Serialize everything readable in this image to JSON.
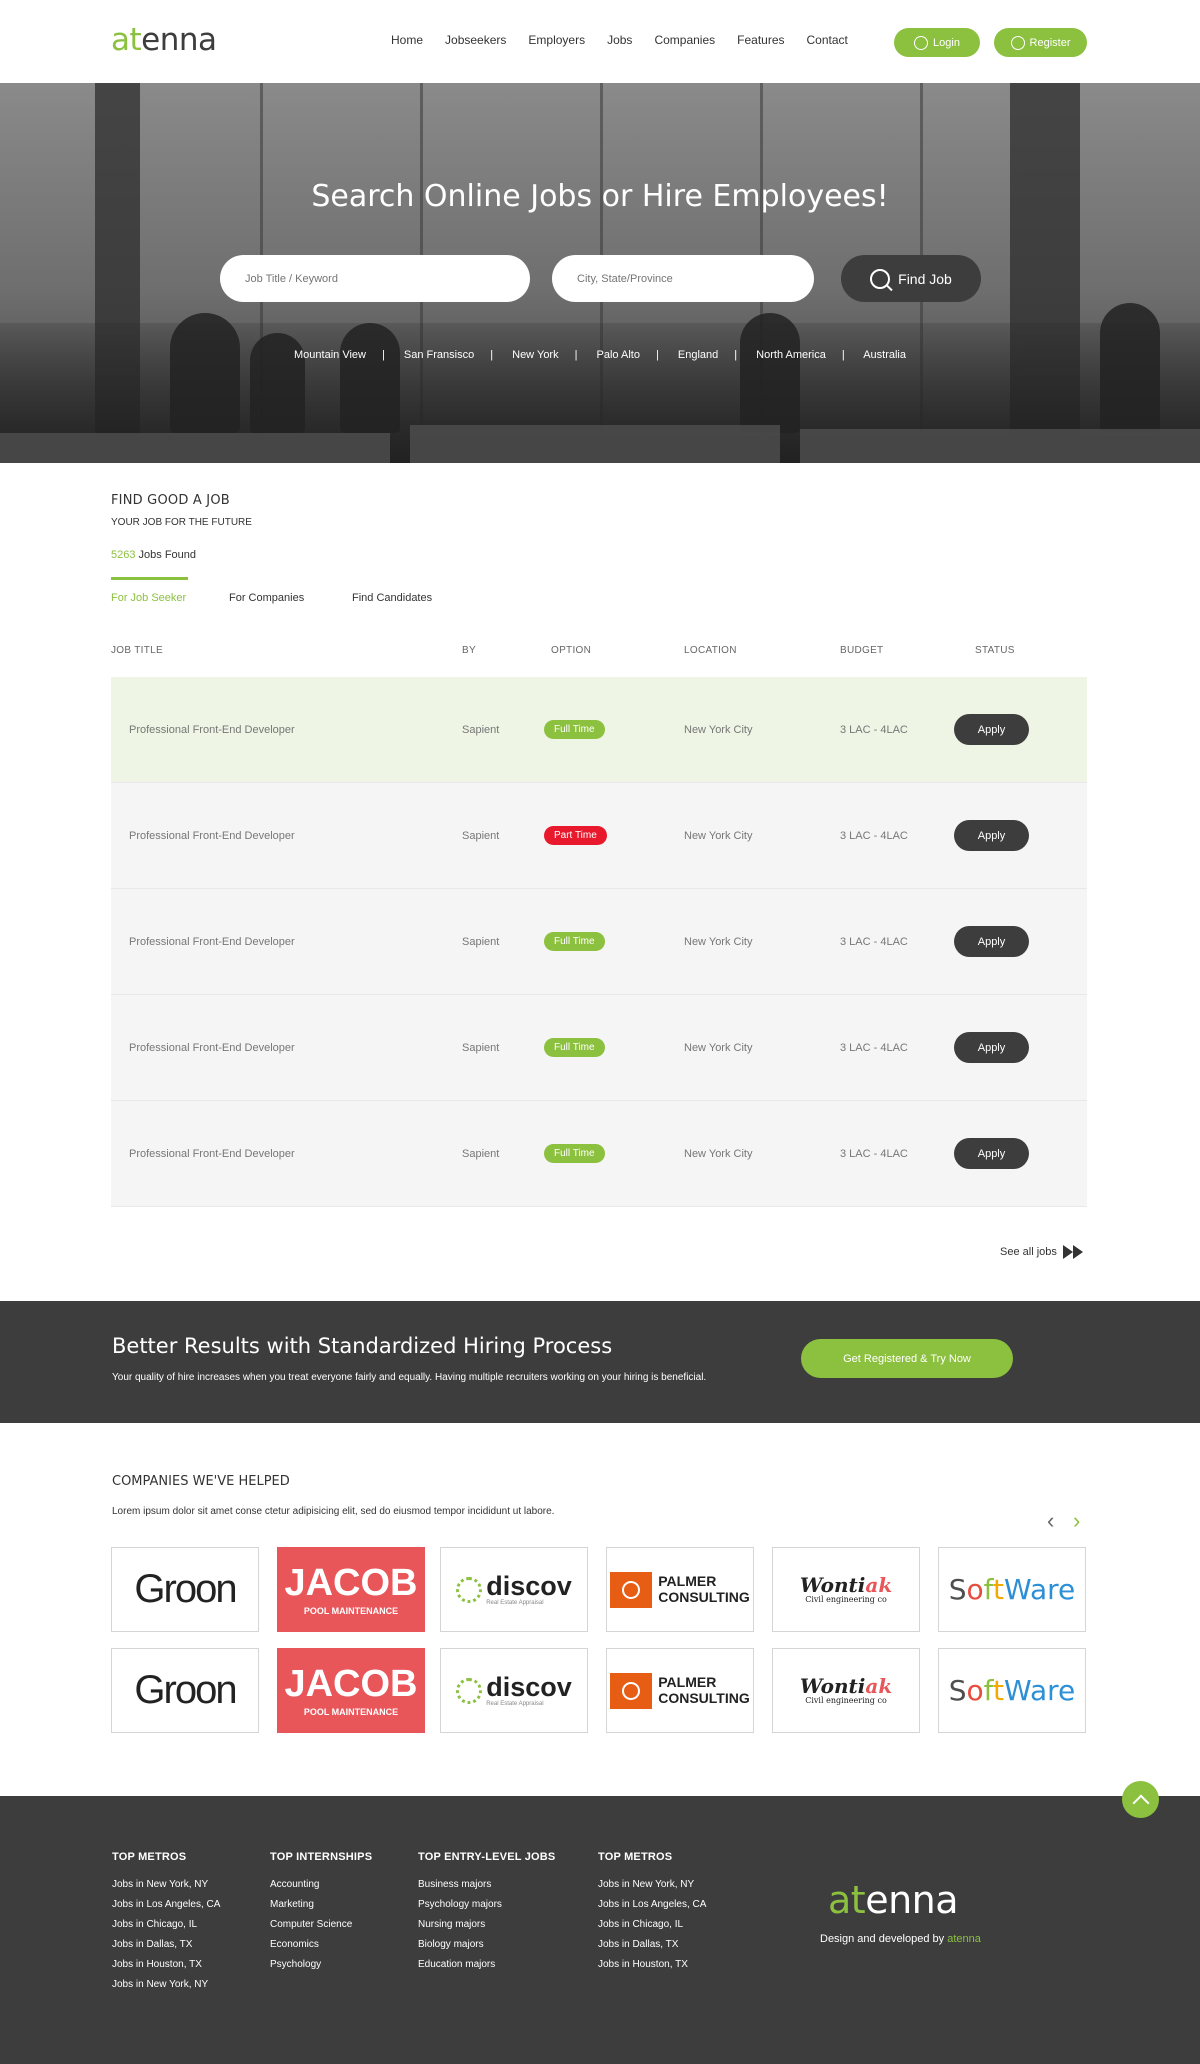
{
  "brand": {
    "logo_prefix": "at",
    "logo_suffix": "enna"
  },
  "nav": [
    {
      "label": "Home"
    },
    {
      "label": "Jobseekers"
    },
    {
      "label": "Employers"
    },
    {
      "label": "Jobs"
    },
    {
      "label": "Companies"
    },
    {
      "label": "Features"
    },
    {
      "label": "Contact"
    }
  ],
  "header": {
    "login_label": "Login",
    "register_label": "Register"
  },
  "hero": {
    "title": "Search Online Jobs or Hire Employees!",
    "keyword_placeholder": "Job Title / Keyword",
    "city_placeholder": "City, State/Province",
    "find_label": "Find Job",
    "cities": [
      "Mountain View",
      "San Fransisco",
      "New York",
      "Palo Alto",
      "England",
      "North America",
      "Australia"
    ],
    "separator": "|"
  },
  "jobs_section": {
    "title": "FIND GOOD A JOB",
    "subtitle": "YOUR JOB FOR THE FUTURE",
    "count": "5263",
    "count_suffix": " Jobs Found",
    "tabs": [
      "For Job Seeker",
      "For Companies",
      "Find Candidates"
    ],
    "columns": [
      "JOB TITLE",
      "BY",
      "OPTION",
      "LOCATION",
      "BUDGET",
      "STATUS"
    ],
    "rows": [
      {
        "title": "Professional Front-End Developer",
        "by": "Sapient",
        "option": "Full Time",
        "option_type": "full",
        "location": "New York City",
        "budget": "3 LAC - 4LAC",
        "status": "Apply"
      },
      {
        "title": "Professional Front-End Developer",
        "by": "Sapient",
        "option": "Part Time",
        "option_type": "part",
        "location": "New York City",
        "budget": "3 LAC - 4LAC",
        "status": "Apply"
      },
      {
        "title": "Professional Front-End Developer",
        "by": "Sapient",
        "option": "Full Time",
        "option_type": "full",
        "location": "New York City",
        "budget": "3 LAC - 4LAC",
        "status": "Apply"
      },
      {
        "title": "Professional Front-End Developer",
        "by": "Sapient",
        "option": "Full Time",
        "option_type": "full",
        "location": "New York City",
        "budget": "3 LAC - 4LAC",
        "status": "Apply"
      },
      {
        "title": "Professional Front-End Developer",
        "by": "Sapient",
        "option": "Full Time",
        "option_type": "full",
        "location": "New York City",
        "budget": "3 LAC - 4LAC",
        "status": "Apply"
      }
    ],
    "see_all": "See all jobs"
  },
  "banner": {
    "title": "Better Results with Standardized Hiring Process",
    "text": "Your quality of hire increases when you treat everyone fairly and equally. Having multiple recruiters working on your hiring is beneficial.",
    "cta": "Get Registered & Try Now"
  },
  "companies": {
    "title": "COMPANIES WE'VE HELPED",
    "text": "Lorem ipsum dolor sit amet conse ctetur adipisicing elit, sed do eiusmod tempor incididunt ut labore.",
    "logos": {
      "groon": "Groon",
      "jacob": "JACOB",
      "jacob_sub": "POOL MAINTENANCE",
      "discov": "discov",
      "discov_sub": "Real Estate Appraisal",
      "palmer_1": "PALMER",
      "palmer_2": "CONSULTING",
      "wontiak_main": "Wonti",
      "wontiak_accent": "ak",
      "wontiak_sub": "Civil engineering co",
      "software_letters": [
        "S",
        "o",
        "f",
        "t",
        "W",
        "a",
        "r",
        "e"
      ]
    }
  },
  "colors": {
    "accent": "#8cc03f",
    "dark": "#3d3d3e",
    "part_time": "#e8192c",
    "software_letters": [
      "#4e4e4e",
      "#e84c3d",
      "#8cc03f",
      "#f2a900",
      "#2d8fd5",
      "#2d8fd5",
      "#2d8fd5",
      "#2d8fd5"
    ]
  },
  "footer": {
    "columns": [
      {
        "title": "TOP METROS",
        "items": [
          "Jobs in New York, NY",
          "Jobs in Los Angeles, CA",
          "Jobs in Chicago, IL",
          "Jobs in Dallas, TX",
          "Jobs in Houston, TX",
          "Jobs in New York, NY"
        ]
      },
      {
        "title": "TOP INTERNSHIPS",
        "items": [
          "Accounting",
          "Marketing",
          "Computer Science",
          "Economics",
          "Psychology"
        ]
      },
      {
        "title": "TOP ENTRY-LEVEL JOBS",
        "items": [
          "Business majors",
          "Psychology majors",
          "Nursing majors",
          "Biology majors",
          "Education majors"
        ]
      },
      {
        "title": "TOP METROS",
        "items": [
          "Jobs in New York, NY",
          "Jobs in Los Angeles, CA",
          "Jobs in Chicago, IL",
          "Jobs in Dallas, TX",
          "Jobs in Houston, TX"
        ]
      }
    ],
    "credit_prefix": "Design and developed by ",
    "credit_brand": "atenna"
  },
  "icons": {
    "login": "user-circle-icon",
    "register": "user-add-icon",
    "search": "search-icon",
    "see_all": "fast-forward-icon",
    "prev": "chevron-left-icon",
    "next": "chevron-right-icon",
    "top": "chevron-up-icon"
  }
}
